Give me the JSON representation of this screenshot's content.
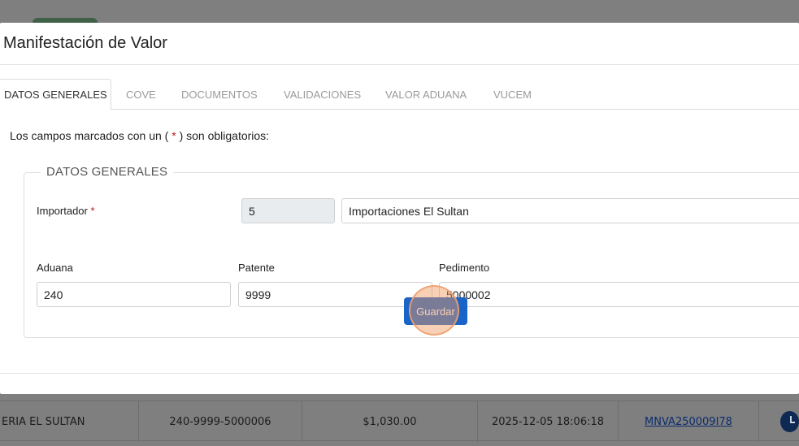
{
  "modal": {
    "title": "Manifestación de Valor"
  },
  "tabs": [
    {
      "label": "DATOS GENERALES",
      "active": true
    },
    {
      "label": "COVE"
    },
    {
      "label": "DOCUMENTOS"
    },
    {
      "label": "VALIDACIONES"
    },
    {
      "label": "VALOR ADUANA"
    },
    {
      "label": "VUCEM"
    }
  ],
  "required_note": {
    "prefix": "Los campos marcados con un (",
    "star": "*",
    "suffix": ") son obligatorios:"
  },
  "section": {
    "legend": "DATOS GENERALES",
    "importador": {
      "label": "Importador",
      "star": "*",
      "code": "5",
      "name": "Importaciones El Sultan"
    },
    "aduana": {
      "label": "Aduana",
      "value": "240"
    },
    "patente": {
      "label": "Patente",
      "value": "9999"
    },
    "pedimento": {
      "label": "Pedimento",
      "value": "5000002"
    },
    "save_label": "Guardar"
  },
  "background_row": {
    "cells": [
      "ERIA EL SULTAN",
      "240-9999-5000006",
      "$1,030.00",
      "2025-12-05 18:06:18",
      "MNVA250009I78"
    ],
    "icon": "clock-icon"
  },
  "colors": {
    "primary": "#1a64c8",
    "required": "#b71c1c",
    "overlay": "#8a8a8a"
  }
}
